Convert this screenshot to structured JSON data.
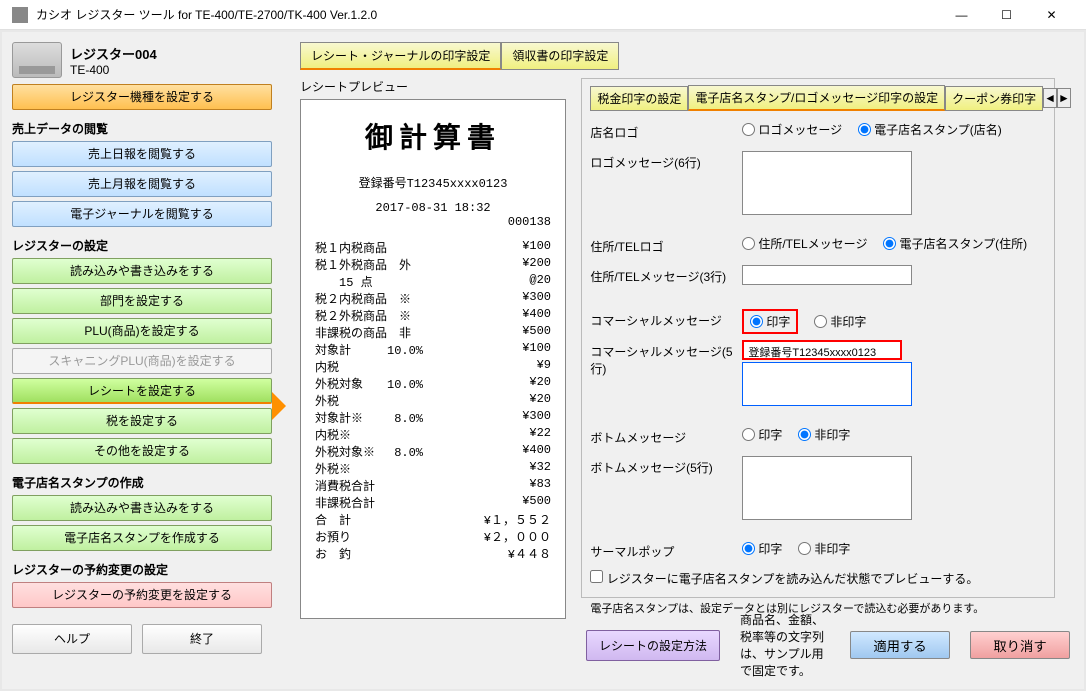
{
  "window": {
    "title": "カシオ レジスター ツール for TE-400/TE-2700/TK-400 Ver.1.2.0",
    "min": "—",
    "max": "☐",
    "close": "✕"
  },
  "header": {
    "reg_name": "レジスター004",
    "reg_model": "TE-400"
  },
  "sidebar": {
    "set_model": "レジスター機種を設定する",
    "sec_sales": "売上データの閲覧",
    "daily": "売上日報を閲覧する",
    "monthly": "売上月報を閲覧する",
    "ejournal": "電子ジャーナルを閲覧する",
    "sec_reg": "レジスターの設定",
    "rw": "読み込みや書き込みをする",
    "dept": "部門を設定する",
    "plu": "PLU(商品)を設定する",
    "scanplu": "スキャニングPLU(商品)を設定する",
    "receipt": "レシートを設定する",
    "tax": "税を設定する",
    "other": "その他を設定する",
    "sec_stamp": "電子店名スタンプの作成",
    "stamp_rw": "読み込みや書き込みをする",
    "stamp_make": "電子店名スタンプを作成する",
    "sec_reserve": "レジスターの予約変更の設定",
    "reserve": "レジスターの予約変更を設定する",
    "help": "ヘルプ",
    "exit": "終了"
  },
  "tabs": {
    "t1": "レシート・ジャーナルの印字設定",
    "t2": "領収書の印字設定"
  },
  "preview_label": "レシートプレビュー",
  "receipt": {
    "title": "御計算書",
    "reg_line": "登録番号T12345xxxx0123",
    "date": "2017-08-31 18:32",
    "ticket": "000138",
    "lines": [
      [
        "税１内税商品",
        "¥100"
      ],
      [
        "税１外税商品　外",
        "¥200"
      ],
      [
        "　　15 点",
        "@20"
      ],
      [
        "税２内税商品　※",
        "¥300"
      ],
      [
        "税２外税商品　※",
        "¥400"
      ],
      [
        "非課税の商品　非",
        "¥500"
      ],
      [
        "対象計　　　10.0%",
        "¥100"
      ],
      [
        "内税",
        "¥9"
      ],
      [
        "外税対象　　10.0%",
        "¥20"
      ],
      [
        "外税",
        "¥20"
      ],
      [
        "対象計※　　 8.0%",
        "¥300"
      ],
      [
        "内税※",
        "¥22"
      ],
      [
        "外税対象※　 8.0%",
        "¥400"
      ],
      [
        "外税※",
        "¥32"
      ],
      [
        "消費税合計",
        "¥83"
      ],
      [
        "非課税合計",
        "¥500"
      ]
    ],
    "total_label": "合　計",
    "total": "¥１，５５２",
    "paid_label": "お預り",
    "paid": "¥２，０００",
    "change_label": "お　釣",
    "change": "¥４４８"
  },
  "sub_tabs": {
    "st1": "税金印字の設定",
    "st2": "電子店名スタンプ/ロゴメッセージ印字の設定",
    "st3": "クーポン券印字"
  },
  "form": {
    "logo_label": "店名ロゴ",
    "logo_opt1": "ロゴメッセージ",
    "logo_opt2": "電子店名スタンプ(店名)",
    "logomsg_label": "ロゴメッセージ(6行)",
    "addr_label": "住所/TELロゴ",
    "addr_opt1": "住所/TELメッセージ",
    "addr_opt2": "電子店名スタンプ(住所)",
    "addrmsg_label": "住所/TELメッセージ(3行)",
    "cm_label": "コマーシャルメッセージ",
    "cm_opt1": "印字",
    "cm_opt2": "非印字",
    "cmmsg_label": "コマーシャルメッセージ(5行)",
    "cmmsg_val": "登録番号T12345xxxx0123",
    "btm_label": "ボトムメッセージ",
    "btm_opt1": "印字",
    "btm_opt2": "非印字",
    "btmmsg_label": "ボトムメッセージ(5行)",
    "thermal_label": "サーマルポップ",
    "thermal_opt1": "印字",
    "thermal_opt2": "非印字",
    "chk": "レジスターに電子店名スタンプを読み込んだ状態でプレビューする。",
    "note": "電子店名スタンプは、設定データとは別にレジスターで読込む必要があります。"
  },
  "footer": {
    "howto": "レシートの設定方法",
    "msg": "商品名、金額、税率等の文字列は、サンプル用で固定です。",
    "apply": "適用する",
    "cancel": "取り消す"
  }
}
